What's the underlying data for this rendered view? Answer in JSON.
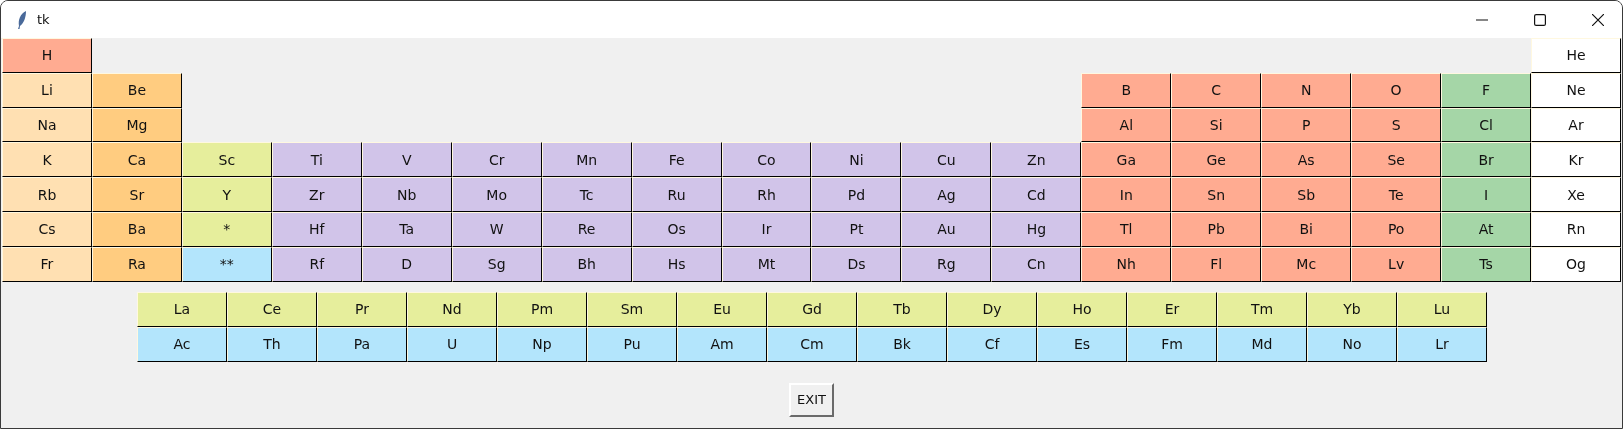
{
  "window": {
    "title": "tk"
  },
  "periods": [
    [
      {
        "symbol": "H",
        "color": "#ffab91"
      },
      {
        "symbol": "He",
        "color": "#ffffff"
      }
    ],
    [
      {
        "symbol": "Li",
        "color": "#ffe0b2"
      },
      {
        "symbol": "Be",
        "color": "#ffcc80"
      },
      {
        "symbol": "B",
        "color": "#ffab91"
      },
      {
        "symbol": "C",
        "color": "#ffab91"
      },
      {
        "symbol": "N",
        "color": "#ffab91"
      },
      {
        "symbol": "O",
        "color": "#ffab91"
      },
      {
        "symbol": "F",
        "color": "#a5d6a7"
      },
      {
        "symbol": "Ne",
        "color": "#ffffff"
      }
    ],
    [
      {
        "symbol": "Na",
        "color": "#ffe0b2"
      },
      {
        "symbol": "Mg",
        "color": "#ffcc80"
      },
      {
        "symbol": "Al",
        "color": "#ffab91"
      },
      {
        "symbol": "Si",
        "color": "#ffab91"
      },
      {
        "symbol": "P",
        "color": "#ffab91"
      },
      {
        "symbol": "S",
        "color": "#ffab91"
      },
      {
        "symbol": "Cl",
        "color": "#a5d6a7"
      },
      {
        "symbol": "Ar",
        "color": "#ffffff"
      }
    ],
    [
      {
        "symbol": "K",
        "color": "#ffe0b2"
      },
      {
        "symbol": "Ca",
        "color": "#ffcc80"
      },
      {
        "symbol": "Sc",
        "color": "#e6ee9c"
      },
      {
        "symbol": "Ti",
        "color": "#d1c4e9"
      },
      {
        "symbol": "V",
        "color": "#d1c4e9"
      },
      {
        "symbol": "Cr",
        "color": "#d1c4e9"
      },
      {
        "symbol": "Mn",
        "color": "#d1c4e9"
      },
      {
        "symbol": "Fe",
        "color": "#d1c4e9"
      },
      {
        "symbol": "Co",
        "color": "#d1c4e9"
      },
      {
        "symbol": "Ni",
        "color": "#d1c4e9"
      },
      {
        "symbol": "Cu",
        "color": "#d1c4e9"
      },
      {
        "symbol": "Zn",
        "color": "#d1c4e9"
      },
      {
        "symbol": "Ga",
        "color": "#ffab91"
      },
      {
        "symbol": "Ge",
        "color": "#ffab91"
      },
      {
        "symbol": "As",
        "color": "#ffab91"
      },
      {
        "symbol": "Se",
        "color": "#ffab91"
      },
      {
        "symbol": "Br",
        "color": "#a5d6a7"
      },
      {
        "symbol": "Kr",
        "color": "#ffffff"
      }
    ],
    [
      {
        "symbol": "Rb",
        "color": "#ffe0b2"
      },
      {
        "symbol": "Sr",
        "color": "#ffcc80"
      },
      {
        "symbol": "Y",
        "color": "#e6ee9c"
      },
      {
        "symbol": "Zr",
        "color": "#d1c4e9"
      },
      {
        "symbol": "Nb",
        "color": "#d1c4e9"
      },
      {
        "symbol": "Mo",
        "color": "#d1c4e9"
      },
      {
        "symbol": "Tc",
        "color": "#d1c4e9"
      },
      {
        "symbol": "Ru",
        "color": "#d1c4e9"
      },
      {
        "symbol": "Rh",
        "color": "#d1c4e9"
      },
      {
        "symbol": "Pd",
        "color": "#d1c4e9"
      },
      {
        "symbol": "Ag",
        "color": "#d1c4e9"
      },
      {
        "symbol": "Cd",
        "color": "#d1c4e9"
      },
      {
        "symbol": "In",
        "color": "#ffab91"
      },
      {
        "symbol": "Sn",
        "color": "#ffab91"
      },
      {
        "symbol": "Sb",
        "color": "#ffab91"
      },
      {
        "symbol": "Te",
        "color": "#ffab91"
      },
      {
        "symbol": "I",
        "color": "#a5d6a7"
      },
      {
        "symbol": "Xe",
        "color": "#ffffff"
      }
    ],
    [
      {
        "symbol": "Cs",
        "color": "#ffe0b2"
      },
      {
        "symbol": "Ba",
        "color": "#ffcc80"
      },
      {
        "symbol": "*",
        "color": "#e6ee9c"
      },
      {
        "symbol": "Hf",
        "color": "#d1c4e9"
      },
      {
        "symbol": "Ta",
        "color": "#d1c4e9"
      },
      {
        "symbol": "W",
        "color": "#d1c4e9"
      },
      {
        "symbol": "Re",
        "color": "#d1c4e9"
      },
      {
        "symbol": "Os",
        "color": "#d1c4e9"
      },
      {
        "symbol": "Ir",
        "color": "#d1c4e9"
      },
      {
        "symbol": "Pt",
        "color": "#d1c4e9"
      },
      {
        "symbol": "Au",
        "color": "#d1c4e9"
      },
      {
        "symbol": "Hg",
        "color": "#d1c4e9"
      },
      {
        "symbol": "Tl",
        "color": "#ffab91"
      },
      {
        "symbol": "Pb",
        "color": "#ffab91"
      },
      {
        "symbol": "Bi",
        "color": "#ffab91"
      },
      {
        "symbol": "Po",
        "color": "#ffab91"
      },
      {
        "symbol": "At",
        "color": "#a5d6a7"
      },
      {
        "symbol": "Rn",
        "color": "#ffffff"
      }
    ],
    [
      {
        "symbol": "Fr",
        "color": "#ffe0b2"
      },
      {
        "symbol": "Ra",
        "color": "#ffcc80"
      },
      {
        "symbol": "**",
        "color": "#b3e5fc"
      },
      {
        "symbol": "Rf",
        "color": "#d1c4e9"
      },
      {
        "symbol": "D",
        "color": "#d1c4e9"
      },
      {
        "symbol": "Sg",
        "color": "#d1c4e9"
      },
      {
        "symbol": "Bh",
        "color": "#d1c4e9"
      },
      {
        "symbol": "Hs",
        "color": "#d1c4e9"
      },
      {
        "symbol": "Mt",
        "color": "#d1c4e9"
      },
      {
        "symbol": "Ds",
        "color": "#d1c4e9"
      },
      {
        "symbol": "Rg",
        "color": "#d1c4e9"
      },
      {
        "symbol": "Cn",
        "color": "#d1c4e9"
      },
      {
        "symbol": "Nh",
        "color": "#ffab91"
      },
      {
        "symbol": "Fl",
        "color": "#ffab91"
      },
      {
        "symbol": "Mc",
        "color": "#ffab91"
      },
      {
        "symbol": "Lv",
        "color": "#ffab91"
      },
      {
        "symbol": "Ts",
        "color": "#a5d6a7"
      },
      {
        "symbol": "Og",
        "color": "#ffffff"
      }
    ]
  ],
  "f_block": [
    [
      {
        "symbol": "La",
        "color": "#e6ee9c"
      },
      {
        "symbol": "Ce",
        "color": "#e6ee9c"
      },
      {
        "symbol": "Pr",
        "color": "#e6ee9c"
      },
      {
        "symbol": "Nd",
        "color": "#e6ee9c"
      },
      {
        "symbol": "Pm",
        "color": "#e6ee9c"
      },
      {
        "symbol": "Sm",
        "color": "#e6ee9c"
      },
      {
        "symbol": "Eu",
        "color": "#e6ee9c"
      },
      {
        "symbol": "Gd",
        "color": "#e6ee9c"
      },
      {
        "symbol": "Tb",
        "color": "#e6ee9c"
      },
      {
        "symbol": "Dy",
        "color": "#e6ee9c"
      },
      {
        "symbol": "Ho",
        "color": "#e6ee9c"
      },
      {
        "symbol": "Er",
        "color": "#e6ee9c"
      },
      {
        "symbol": "Tm",
        "color": "#e6ee9c"
      },
      {
        "symbol": "Yb",
        "color": "#e6ee9c"
      },
      {
        "symbol": "Lu",
        "color": "#e6ee9c"
      }
    ],
    [
      {
        "symbol": "Ac",
        "color": "#b3e5fc"
      },
      {
        "symbol": "Th",
        "color": "#b3e5fc"
      },
      {
        "symbol": "Pa",
        "color": "#b3e5fc"
      },
      {
        "symbol": "U",
        "color": "#b3e5fc"
      },
      {
        "symbol": "Np",
        "color": "#b3e5fc"
      },
      {
        "symbol": "Pu",
        "color": "#b3e5fc"
      },
      {
        "symbol": "Am",
        "color": "#b3e5fc"
      },
      {
        "symbol": "Cm",
        "color": "#b3e5fc"
      },
      {
        "symbol": "Bk",
        "color": "#b3e5fc"
      },
      {
        "symbol": "Cf",
        "color": "#b3e5fc"
      },
      {
        "symbol": "Es",
        "color": "#b3e5fc"
      },
      {
        "symbol": "Fm",
        "color": "#b3e5fc"
      },
      {
        "symbol": "Md",
        "color": "#b3e5fc"
      },
      {
        "symbol": "No",
        "color": "#b3e5fc"
      },
      {
        "symbol": "Lr",
        "color": "#b3e5fc"
      }
    ]
  ],
  "exit_button": {
    "label": "EXIT"
  }
}
